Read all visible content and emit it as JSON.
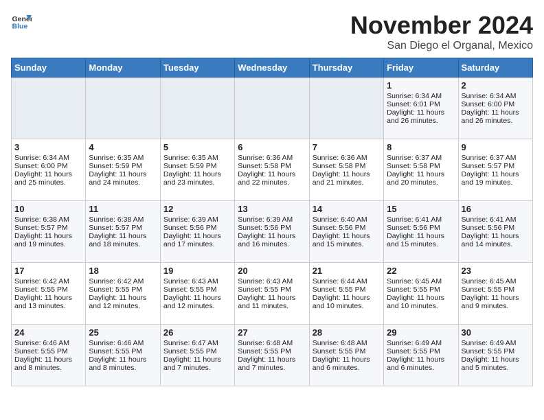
{
  "logo": {
    "line1": "General",
    "line2": "Blue"
  },
  "title": "November 2024",
  "location": "San Diego el Organal, Mexico",
  "days_header": [
    "Sunday",
    "Monday",
    "Tuesday",
    "Wednesday",
    "Thursday",
    "Friday",
    "Saturday"
  ],
  "weeks": [
    [
      {
        "day": "",
        "info": ""
      },
      {
        "day": "",
        "info": ""
      },
      {
        "day": "",
        "info": ""
      },
      {
        "day": "",
        "info": ""
      },
      {
        "day": "",
        "info": ""
      },
      {
        "day": "1",
        "info": "Sunrise: 6:34 AM\nSunset: 6:01 PM\nDaylight: 11 hours\nand 26 minutes."
      },
      {
        "day": "2",
        "info": "Sunrise: 6:34 AM\nSunset: 6:00 PM\nDaylight: 11 hours\nand 26 minutes."
      }
    ],
    [
      {
        "day": "3",
        "info": "Sunrise: 6:34 AM\nSunset: 6:00 PM\nDaylight: 11 hours\nand 25 minutes."
      },
      {
        "day": "4",
        "info": "Sunrise: 6:35 AM\nSunset: 5:59 PM\nDaylight: 11 hours\nand 24 minutes."
      },
      {
        "day": "5",
        "info": "Sunrise: 6:35 AM\nSunset: 5:59 PM\nDaylight: 11 hours\nand 23 minutes."
      },
      {
        "day": "6",
        "info": "Sunrise: 6:36 AM\nSunset: 5:58 PM\nDaylight: 11 hours\nand 22 minutes."
      },
      {
        "day": "7",
        "info": "Sunrise: 6:36 AM\nSunset: 5:58 PM\nDaylight: 11 hours\nand 21 minutes."
      },
      {
        "day": "8",
        "info": "Sunrise: 6:37 AM\nSunset: 5:58 PM\nDaylight: 11 hours\nand 20 minutes."
      },
      {
        "day": "9",
        "info": "Sunrise: 6:37 AM\nSunset: 5:57 PM\nDaylight: 11 hours\nand 19 minutes."
      }
    ],
    [
      {
        "day": "10",
        "info": "Sunrise: 6:38 AM\nSunset: 5:57 PM\nDaylight: 11 hours\nand 19 minutes."
      },
      {
        "day": "11",
        "info": "Sunrise: 6:38 AM\nSunset: 5:57 PM\nDaylight: 11 hours\nand 18 minutes."
      },
      {
        "day": "12",
        "info": "Sunrise: 6:39 AM\nSunset: 5:56 PM\nDaylight: 11 hours\nand 17 minutes."
      },
      {
        "day": "13",
        "info": "Sunrise: 6:39 AM\nSunset: 5:56 PM\nDaylight: 11 hours\nand 16 minutes."
      },
      {
        "day": "14",
        "info": "Sunrise: 6:40 AM\nSunset: 5:56 PM\nDaylight: 11 hours\nand 15 minutes."
      },
      {
        "day": "15",
        "info": "Sunrise: 6:41 AM\nSunset: 5:56 PM\nDaylight: 11 hours\nand 15 minutes."
      },
      {
        "day": "16",
        "info": "Sunrise: 6:41 AM\nSunset: 5:56 PM\nDaylight: 11 hours\nand 14 minutes."
      }
    ],
    [
      {
        "day": "17",
        "info": "Sunrise: 6:42 AM\nSunset: 5:55 PM\nDaylight: 11 hours\nand 13 minutes."
      },
      {
        "day": "18",
        "info": "Sunrise: 6:42 AM\nSunset: 5:55 PM\nDaylight: 11 hours\nand 12 minutes."
      },
      {
        "day": "19",
        "info": "Sunrise: 6:43 AM\nSunset: 5:55 PM\nDaylight: 11 hours\nand 12 minutes."
      },
      {
        "day": "20",
        "info": "Sunrise: 6:43 AM\nSunset: 5:55 PM\nDaylight: 11 hours\nand 11 minutes."
      },
      {
        "day": "21",
        "info": "Sunrise: 6:44 AM\nSunset: 5:55 PM\nDaylight: 11 hours\nand 10 minutes."
      },
      {
        "day": "22",
        "info": "Sunrise: 6:45 AM\nSunset: 5:55 PM\nDaylight: 11 hours\nand 10 minutes."
      },
      {
        "day": "23",
        "info": "Sunrise: 6:45 AM\nSunset: 5:55 PM\nDaylight: 11 hours\nand 9 minutes."
      }
    ],
    [
      {
        "day": "24",
        "info": "Sunrise: 6:46 AM\nSunset: 5:55 PM\nDaylight: 11 hours\nand 8 minutes."
      },
      {
        "day": "25",
        "info": "Sunrise: 6:46 AM\nSunset: 5:55 PM\nDaylight: 11 hours\nand 8 minutes."
      },
      {
        "day": "26",
        "info": "Sunrise: 6:47 AM\nSunset: 5:55 PM\nDaylight: 11 hours\nand 7 minutes."
      },
      {
        "day": "27",
        "info": "Sunrise: 6:48 AM\nSunset: 5:55 PM\nDaylight: 11 hours\nand 7 minutes."
      },
      {
        "day": "28",
        "info": "Sunrise: 6:48 AM\nSunset: 5:55 PM\nDaylight: 11 hours\nand 6 minutes."
      },
      {
        "day": "29",
        "info": "Sunrise: 6:49 AM\nSunset: 5:55 PM\nDaylight: 11 hours\nand 6 minutes."
      },
      {
        "day": "30",
        "info": "Sunrise: 6:49 AM\nSunset: 5:55 PM\nDaylight: 11 hours\nand 5 minutes."
      }
    ]
  ]
}
